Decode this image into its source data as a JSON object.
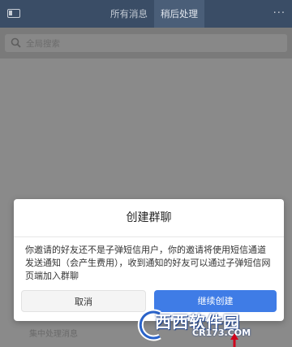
{
  "topbar": {
    "tabs": [
      {
        "label": "所有消息"
      },
      {
        "label": "稍后处理"
      }
    ],
    "more_label": "···"
  },
  "search": {
    "placeholder": "全局搜索"
  },
  "background": {
    "bottom_text": "集中处理消息"
  },
  "dialog": {
    "title": "创建群聊",
    "message": "你邀请的好友还不是子弹短信用户，你的邀请将使用短信通道发送通知（会产生费用），收到通知的好友可以通过子弹短信网页端加入群聊",
    "cancel_label": "取消",
    "continue_label": "继续创建"
  },
  "watermark": {
    "brand": "西西软件园",
    "domain": "CR173.COM"
  },
  "colors": {
    "topbar": "#3a4d66",
    "primary_button": "#3f7ce6"
  }
}
